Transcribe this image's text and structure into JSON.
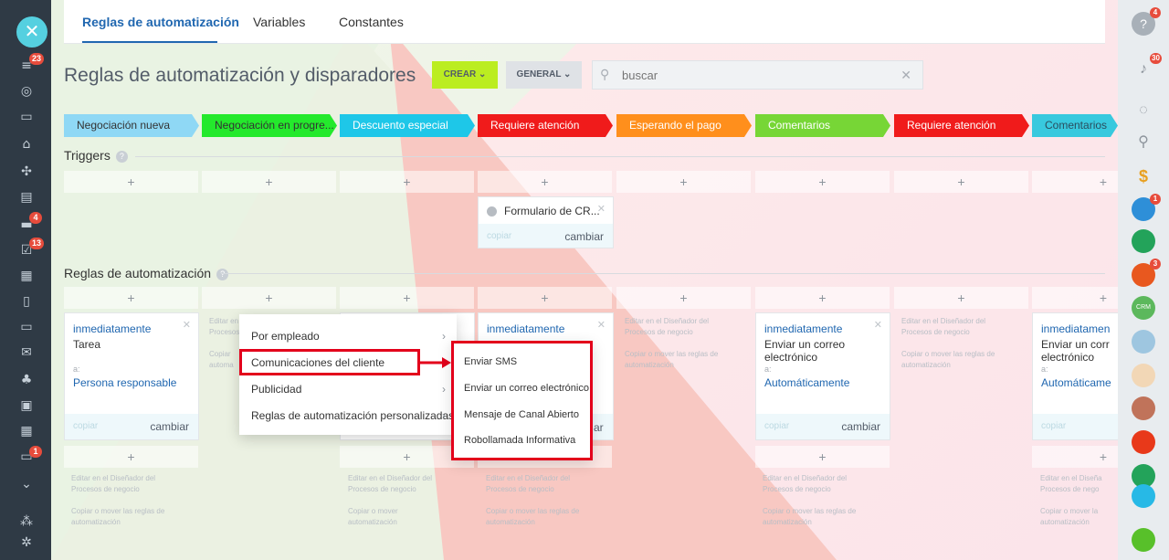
{
  "tabs": [
    {
      "label": "Reglas de automatización"
    },
    {
      "label": "Variables"
    },
    {
      "label": "Constantes"
    }
  ],
  "title": "Reglas de automatización y disparadores",
  "toolbar": {
    "crear": "CREAR",
    "general": "GENERAL"
  },
  "search": {
    "placeholder": "buscar"
  },
  "stages": [
    {
      "label": "Negociación nueva",
      "color": "#8fd8f5"
    },
    {
      "label": "Negociación en progre...",
      "color": "#24e92c"
    },
    {
      "label": "Descuento especial",
      "color": "#1ec7e8"
    },
    {
      "label": "Requiere atención",
      "color": "#f01b1b"
    },
    {
      "label": "Esperando el pago",
      "color": "#ff8f1c"
    },
    {
      "label": "Comentarios",
      "color": "#77d636"
    },
    {
      "label": "Requiere atención",
      "color": "#f01b1b"
    },
    {
      "label": "Comentarios",
      "color": "#38c9de"
    }
  ],
  "sections": {
    "triggers": "Triggers",
    "rules": "Reglas de automatización"
  },
  "plus": "+",
  "trigger_card": {
    "title": "Formulario de CR...",
    "copy": "copiar",
    "change": "cambiar"
  },
  "rule_cards": {
    "card1": {
      "timing": "inmediatamente",
      "task": "Tarea",
      "to_label": "a:",
      "to": "Persona responsable",
      "copy": "copiar",
      "change": "cambiar"
    },
    "card3": {
      "timing": "inmediatamente"
    },
    "card5": {
      "timing": "inmediatamente",
      "task1": "Enviar un correo",
      "task2": "electrónico",
      "to_label": "a:",
      "to": "Automáticamente",
      "copy": "copiar",
      "change": "cambiar"
    },
    "card7": {
      "timing": "inmediatamen",
      "task1": "Enviar un corr",
      "task2": "electrónico",
      "to_label": "a:",
      "to": "Automáticame",
      "copy": "copiar"
    }
  },
  "ghost": {
    "edit": "Editar en el Diseñador del",
    "edit2": "Procesos de negocio",
    "move": "Copiar o mover las reglas de",
    "move2": "automatización",
    "partial_edit": "Editar en",
    "partial_proc": "Procesos",
    "partial_copy": "Copiar",
    "partial_auto": "automa",
    "partial_copy_move": "Copiar o mover",
    "partial_auto2": "automatización",
    "partial_dise": "Editar en el Diseña",
    "partial_nego": "Procesos de nego",
    "partial_mover": "Copiar o mover la",
    "partial_ar": "ar"
  },
  "menu": [
    {
      "label": "Por empleado"
    },
    {
      "label": "Comunicaciones del cliente"
    },
    {
      "label": "Publicidad"
    },
    {
      "label": "Reglas de automatización personalizadas"
    }
  ],
  "submenu": [
    {
      "label": "Enviar SMS"
    },
    {
      "label": "Enviar un correo electrónico"
    },
    {
      "label": "Mensaje de Canal Abierto"
    },
    {
      "label": "Robollamada Informativa"
    }
  ],
  "badges": {
    "rail_filter": "23",
    "rail_chat": "4",
    "rail_tasks": "13",
    "rail_box": "1",
    "help": "4",
    "bell": "30",
    "lock1": "1",
    "group": "3"
  },
  "right_rail_labels": {
    "crm": "CRM"
  }
}
